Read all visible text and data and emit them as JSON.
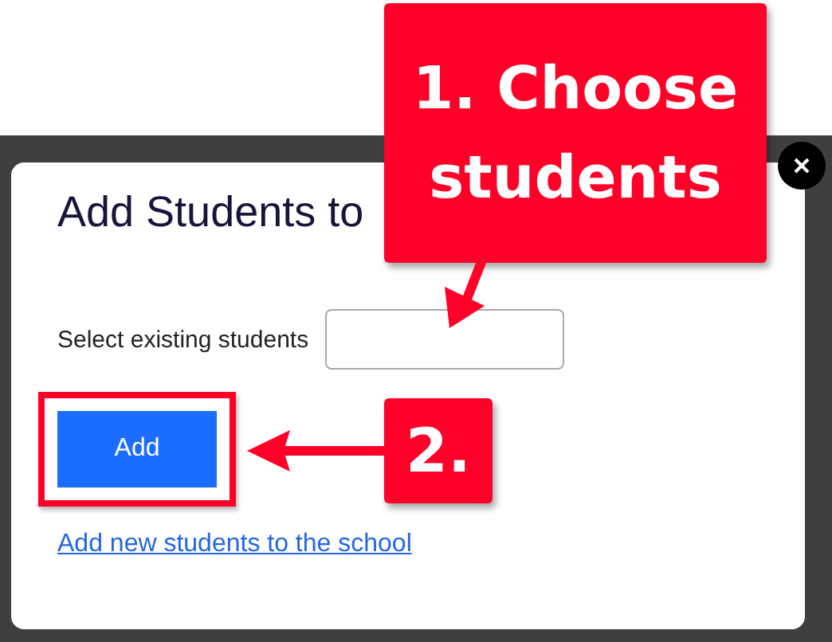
{
  "dialog": {
    "title": "Add Students to",
    "field_label": "Select existing students",
    "button": "Add",
    "link": "Add new students to the school"
  },
  "callouts": [
    {
      "text": "1. Choose students",
      "kind": "top"
    },
    {
      "text": "2.",
      "kind": "side"
    }
  ]
}
